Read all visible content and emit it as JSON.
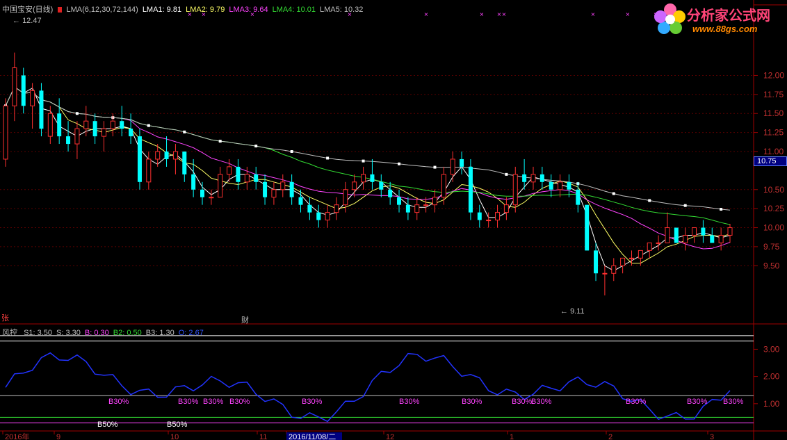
{
  "header": {
    "stock_name": "中国宝安(日线)",
    "items": [
      {
        "text": "LMA(6,12,30,72,144)",
        "color": "#c0c0c0"
      },
      {
        "text": "LMA1: 9.81",
        "color": "#ffffff"
      },
      {
        "text": "LMA2: 9.79",
        "color": "#ffff66"
      },
      {
        "text": "LMA3: 9.64",
        "color": "#ff44ff"
      },
      {
        "text": "LMA4: 10.01",
        "color": "#33dd33"
      },
      {
        "text": "LMA5: 10.32",
        "color": "#c0c0c0"
      }
    ]
  },
  "logo": {
    "title": "分析家公式网",
    "url": "www.88gs.com"
  },
  "price_labels": {
    "high": "12.47",
    "low": "9.11",
    "current": "10.75"
  },
  "price_axis": {
    "ticks": [
      "12.00",
      "11.75",
      "11.50",
      "11.25",
      "11.00",
      "10.50",
      "10.25",
      "10.00",
      "9.75",
      "9.50"
    ]
  },
  "markers": {
    "left": "张",
    "mid": "财"
  },
  "indicator": {
    "title": "风控",
    "items": [
      {
        "text": "S1: 3.50",
        "color": "#c0c0c0"
      },
      {
        "text": "S: 3.30",
        "color": "#c0c0c0"
      },
      {
        "text": "B: 0.30",
        "color": "#ff44ff"
      },
      {
        "text": "B2: 0.50",
        "color": "#33dd33"
      },
      {
        "text": "B3: 1.30",
        "color": "#c0c0c0"
      },
      {
        "text": "O: 2.67",
        "color": "#3355ff"
      }
    ],
    "axis_ticks": [
      "3.00",
      "2.00",
      "1.00"
    ],
    "b30_label": "B30%",
    "b50_label": "B50%"
  },
  "date_axis": {
    "labels": [
      "2016年",
      "9",
      "10",
      "11",
      "2016/11/08/二",
      "12",
      "1",
      "2",
      "3"
    ]
  },
  "chart_data": {
    "type": "line",
    "title": "中国宝安(日线)",
    "ylim": [
      9.0,
      12.6
    ],
    "ma_lines": [
      {
        "name": "LMA1",
        "color": "#ffffff"
      },
      {
        "name": "LMA2",
        "color": "#ffff66"
      },
      {
        "name": "LMA3",
        "color": "#ff44ff"
      },
      {
        "name": "LMA4",
        "color": "#33dd33"
      },
      {
        "name": "LMA5",
        "color": "#c0c0c0"
      }
    ],
    "candles_ohlc": [
      [
        10.9,
        11.7,
        10.8,
        11.6
      ],
      [
        11.6,
        12.3,
        11.4,
        12.1
      ],
      [
        12.0,
        12.1,
        11.5,
        11.6
      ],
      [
        11.6,
        11.9,
        11.3,
        11.8
      ],
      [
        11.8,
        11.9,
        11.2,
        11.3
      ],
      [
        11.2,
        11.6,
        11.1,
        11.5
      ],
      [
        11.5,
        11.7,
        11.1,
        11.2
      ],
      [
        11.2,
        11.4,
        11.0,
        11.1
      ],
      [
        11.1,
        11.4,
        10.9,
        11.3
      ],
      [
        11.3,
        11.6,
        11.2,
        11.4
      ],
      [
        11.4,
        11.5,
        11.1,
        11.2
      ],
      [
        11.2,
        11.4,
        11.0,
        11.3
      ],
      [
        11.3,
        11.5,
        11.2,
        11.4
      ],
      [
        11.4,
        11.6,
        11.2,
        11.3
      ],
      [
        11.3,
        11.5,
        11.1,
        11.2
      ],
      [
        11.2,
        11.3,
        10.5,
        10.6
      ],
      [
        10.6,
        11.0,
        10.5,
        10.9
      ],
      [
        10.9,
        11.1,
        10.8,
        11.0
      ],
      [
        11.0,
        11.2,
        10.8,
        10.9
      ],
      [
        10.9,
        11.1,
        10.7,
        11.0
      ],
      [
        11.0,
        11.0,
        10.6,
        10.7
      ],
      [
        10.7,
        10.9,
        10.4,
        10.5
      ],
      [
        10.5,
        10.6,
        10.3,
        10.4
      ],
      [
        10.4,
        10.5,
        10.3,
        10.4
      ],
      [
        10.4,
        10.8,
        10.4,
        10.7
      ],
      [
        10.7,
        10.9,
        10.6,
        10.8
      ],
      [
        10.8,
        10.9,
        10.5,
        10.6
      ],
      [
        10.6,
        10.8,
        10.5,
        10.7
      ],
      [
        10.7,
        10.8,
        10.5,
        10.6
      ],
      [
        10.6,
        10.7,
        10.3,
        10.4
      ],
      [
        10.4,
        10.6,
        10.3,
        10.5
      ],
      [
        10.5,
        10.7,
        10.4,
        10.6
      ],
      [
        10.6,
        10.7,
        10.3,
        10.4
      ],
      [
        10.4,
        10.5,
        10.2,
        10.3
      ],
      [
        10.3,
        10.4,
        10.1,
        10.2
      ],
      [
        10.2,
        10.3,
        10.0,
        10.1
      ],
      [
        10.1,
        10.3,
        10.0,
        10.2
      ],
      [
        10.2,
        10.4,
        10.1,
        10.3
      ],
      [
        10.3,
        10.6,
        10.2,
        10.5
      ],
      [
        10.5,
        10.7,
        10.4,
        10.6
      ],
      [
        10.6,
        10.8,
        10.5,
        10.7
      ],
      [
        10.7,
        10.9,
        10.5,
        10.6
      ],
      [
        10.6,
        10.7,
        10.4,
        10.5
      ],
      [
        10.5,
        10.6,
        10.3,
        10.4
      ],
      [
        10.4,
        10.5,
        10.2,
        10.3
      ],
      [
        10.3,
        10.4,
        10.1,
        10.2
      ],
      [
        10.2,
        10.4,
        10.1,
        10.3
      ],
      [
        10.3,
        10.4,
        10.2,
        10.3
      ],
      [
        10.3,
        10.5,
        10.2,
        10.4
      ],
      [
        10.4,
        10.8,
        10.3,
        10.7
      ],
      [
        10.7,
        11.0,
        10.6,
        10.9
      ],
      [
        10.9,
        11.0,
        10.7,
        10.8
      ],
      [
        10.8,
        10.9,
        10.1,
        10.2
      ],
      [
        10.2,
        10.3,
        10.0,
        10.1
      ],
      [
        10.1,
        10.2,
        10.0,
        10.1
      ],
      [
        10.1,
        10.3,
        10.0,
        10.2
      ],
      [
        10.2,
        10.4,
        10.1,
        10.3
      ],
      [
        10.3,
        10.8,
        10.2,
        10.7
      ],
      [
        10.7,
        10.9,
        10.5,
        10.6
      ],
      [
        10.6,
        10.8,
        10.5,
        10.7
      ],
      [
        10.7,
        10.8,
        10.5,
        10.6
      ],
      [
        10.6,
        10.7,
        10.4,
        10.5
      ],
      [
        10.5,
        10.7,
        10.4,
        10.6
      ],
      [
        10.6,
        10.7,
        10.4,
        10.5
      ],
      [
        10.5,
        10.6,
        10.2,
        10.3
      ],
      [
        10.3,
        10.3,
        9.7,
        9.7
      ],
      [
        9.7,
        9.8,
        9.3,
        9.4
      ],
      [
        9.4,
        9.5,
        9.11,
        9.4
      ],
      [
        9.4,
        9.6,
        9.3,
        9.5
      ],
      [
        9.5,
        9.6,
        9.4,
        9.6
      ],
      [
        9.6,
        9.7,
        9.5,
        9.6
      ],
      [
        9.6,
        9.7,
        9.5,
        9.7
      ],
      [
        9.7,
        9.8,
        9.6,
        9.8
      ],
      [
        9.8,
        9.9,
        9.7,
        9.8
      ],
      [
        9.8,
        10.2,
        9.8,
        10.0
      ],
      [
        10.0,
        10.0,
        9.8,
        9.8
      ],
      [
        9.8,
        10.0,
        9.7,
        9.9
      ],
      [
        9.9,
        10.0,
        9.8,
        10.0
      ],
      [
        10.0,
        10.1,
        9.8,
        9.9
      ],
      [
        9.9,
        10.0,
        9.8,
        9.8
      ],
      [
        9.8,
        10.0,
        9.7,
        9.9
      ],
      [
        9.9,
        10.05,
        9.8,
        10.0
      ]
    ]
  }
}
